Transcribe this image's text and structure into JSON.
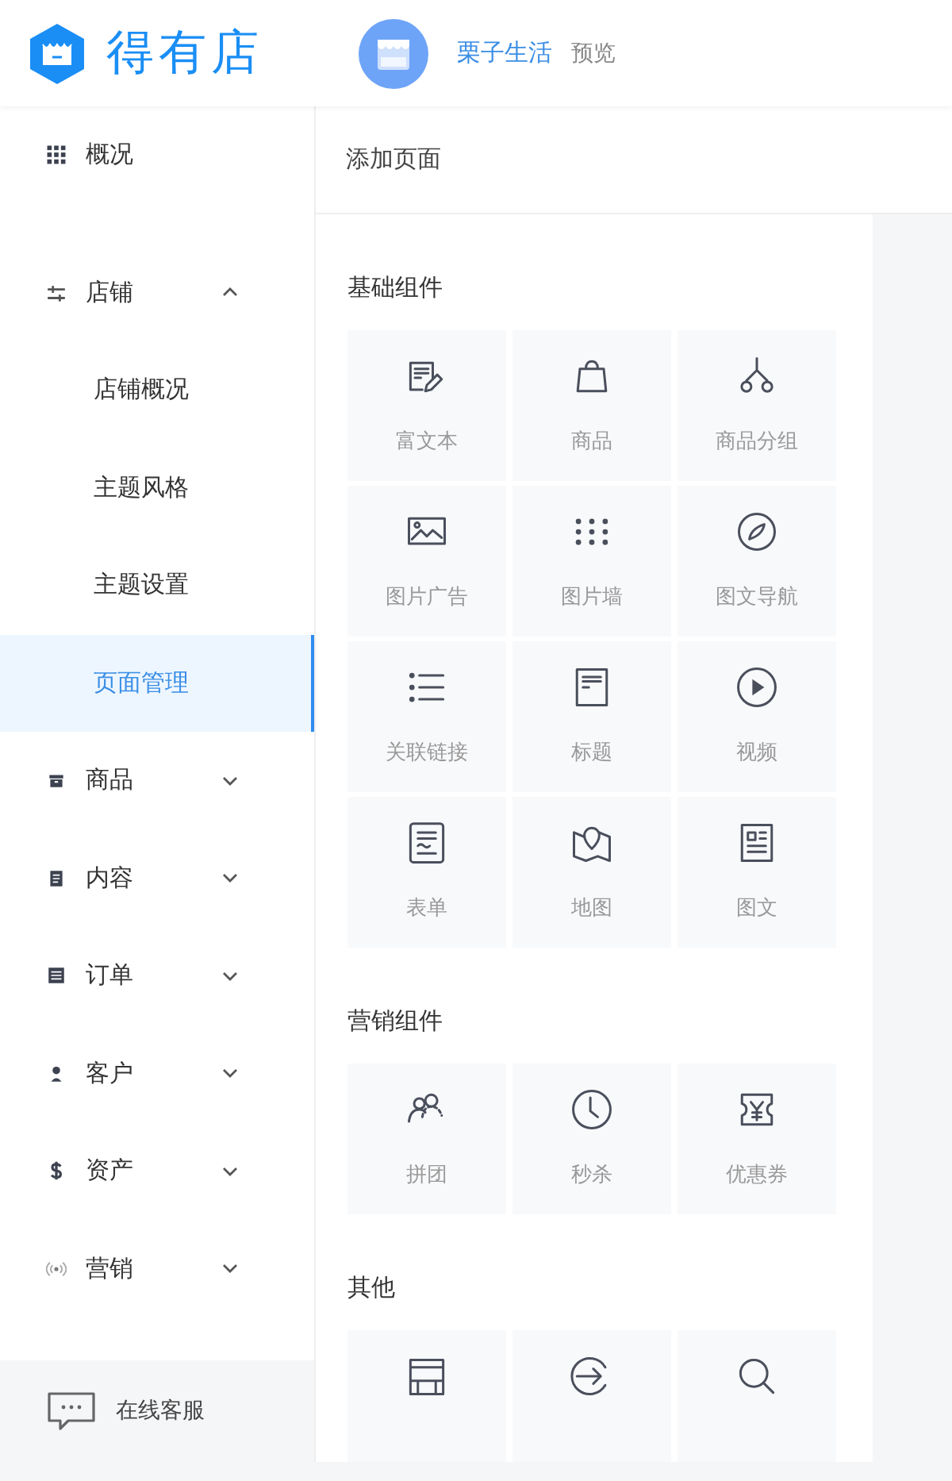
{
  "header": {
    "logo_text": "得有店",
    "shop_name": "栗子生活",
    "preview_link": "预览"
  },
  "sidebar": {
    "items": [
      {
        "label": "概况",
        "selected": false
      },
      {
        "label": "店铺",
        "selected": false,
        "expanded": true,
        "children": [
          {
            "label": "店铺概况",
            "selected": false
          },
          {
            "label": "主题风格",
            "selected": false
          },
          {
            "label": "主题设置",
            "selected": false
          },
          {
            "label": "页面管理",
            "selected": true
          }
        ]
      },
      {
        "label": "商品",
        "selected": false,
        "expanded": false
      },
      {
        "label": "内容",
        "selected": false,
        "expanded": false
      },
      {
        "label": "订单",
        "selected": false,
        "expanded": false
      },
      {
        "label": "客户",
        "selected": false,
        "expanded": false
      },
      {
        "label": "资产",
        "selected": false,
        "expanded": false
      },
      {
        "label": "营销",
        "selected": false,
        "expanded": false
      }
    ],
    "support_button": "在线客服"
  },
  "main": {
    "page_title": "添加页面",
    "sections": [
      {
        "title": "基础组件",
        "components": [
          {
            "kind": "labeled",
            "label": "富文本"
          },
          {
            "kind": "labeled",
            "label": "商品"
          },
          {
            "kind": "labeled",
            "label": "商品分组"
          },
          {
            "kind": "labeled",
            "label": "图片广告"
          },
          {
            "kind": "labeled",
            "label": "图片墙"
          },
          {
            "kind": "labeled",
            "label": "图文导航"
          },
          {
            "kind": "labeled",
            "label": "关联链接"
          },
          {
            "kind": "labeled",
            "label": "标题"
          },
          {
            "kind": "labeled",
            "label": "视频"
          },
          {
            "kind": "labeled",
            "label": "表单"
          },
          {
            "kind": "labeled",
            "label": "地图"
          },
          {
            "kind": "labeled",
            "label": "图文"
          }
        ]
      },
      {
        "title": "营销组件",
        "components": [
          {
            "kind": "labeled",
            "label": "拼团"
          },
          {
            "kind": "labeled",
            "label": "秒杀"
          },
          {
            "kind": "labeled",
            "label": "优惠券"
          }
        ]
      },
      {
        "title": "其他",
        "components": [
          {
            "kind": "icon"
          },
          {
            "kind": "icon"
          },
          {
            "kind": "icon"
          }
        ]
      }
    ]
  }
}
